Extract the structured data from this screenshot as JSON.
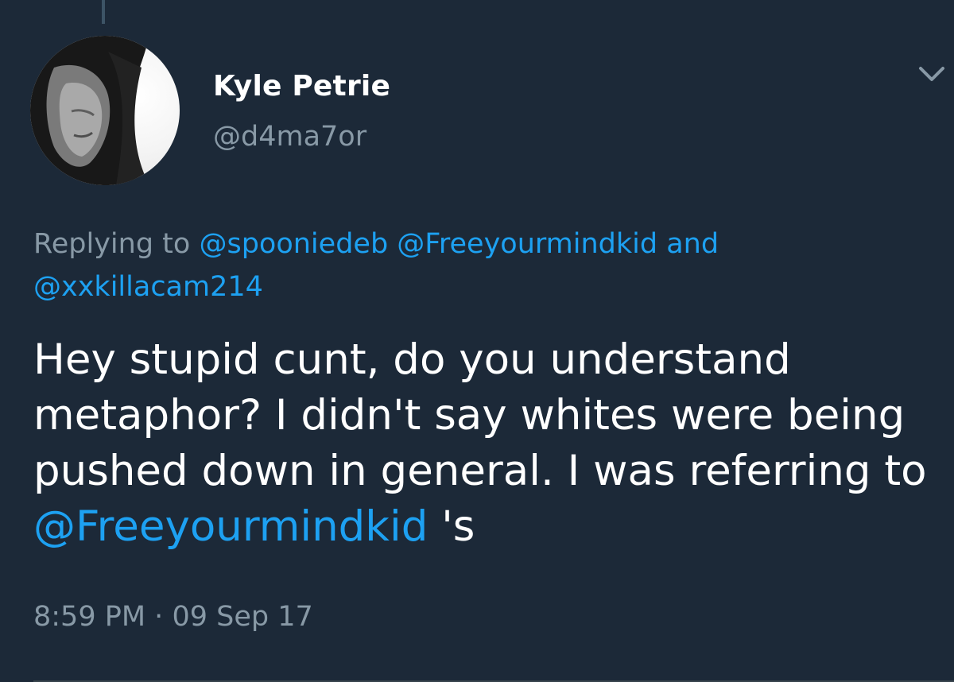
{
  "author": {
    "name": "Kyle Petrie",
    "handle": "@d4ma7or"
  },
  "reply": {
    "prefix": "Replying to",
    "mention_1": "@spooniedeb",
    "mention_2": "@Freeyourmindkid",
    "conjunction": "and",
    "mention_3": "@xxkillacam214"
  },
  "tweet": {
    "text_before": "Hey stupid cunt, do you understand metaphor? I didn't say whites were being pushed down in general. I was referring to",
    "mention": "@Freeyourmindkid",
    "text_after": "'s"
  },
  "timestamp": {
    "time": "8:59 PM",
    "separator": "·",
    "date": "09 Sep 17"
  },
  "icons": {
    "avatar": "avatar-photo",
    "menu": "chevron-down-icon"
  },
  "colors": {
    "background": "#1c2938",
    "text": "#ffffff",
    "secondary": "#8899a6",
    "link": "#1da1f2"
  }
}
